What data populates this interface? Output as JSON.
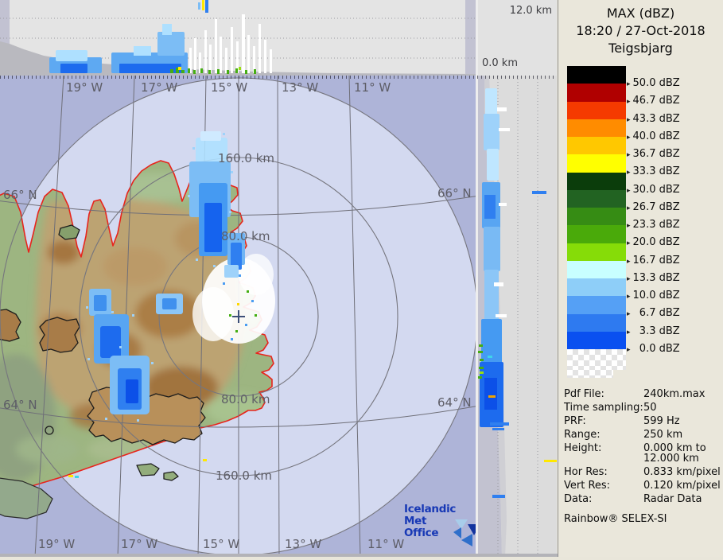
{
  "header": {
    "product": "MAX (dBZ)",
    "datetime": "18:20 / 27-Oct-2018",
    "station": "Teigsbjarg"
  },
  "vaxis": {
    "max": "12.0 km",
    "min": "0.0 km"
  },
  "map": {
    "lon_top": [
      "19° W",
      "17° W",
      "15° W",
      "13° W",
      "11° W"
    ],
    "lon_bottom": [
      "19° W",
      "17° W",
      "15° W",
      "13° W",
      "11° W"
    ],
    "lat_left": [
      "66° N",
      "64° N"
    ],
    "lat_right": [
      "66° N",
      "64° N"
    ],
    "rings": [
      "160.0 km",
      "80.0 km",
      "80.0 km",
      "160.0 km"
    ],
    "logo": {
      "line1": "Icelandic Met",
      "line2": "Office"
    }
  },
  "legend": {
    "bands": [
      {
        "color": "#000000",
        "label": "50.0 dBZ"
      },
      {
        "color": "#b00000",
        "label": "46.7 dBZ"
      },
      {
        "color": "#f53a00",
        "label": "43.3 dBZ"
      },
      {
        "color": "#ff8c00",
        "label": "40.0 dBZ"
      },
      {
        "color": "#ffc800",
        "label": "36.7 dBZ"
      },
      {
        "color": "#ffff00",
        "label": "33.3 dBZ"
      },
      {
        "color": "#0b3d0b",
        "label": "30.0 dBZ"
      },
      {
        "color": "#226322",
        "label": "26.7 dBZ"
      },
      {
        "color": "#368c14",
        "label": "23.3 dBZ"
      },
      {
        "color": "#4aaa0a",
        "label": "20.0 dBZ"
      },
      {
        "color": "#86dc08",
        "label": "16.7 dBZ"
      },
      {
        "color": "#c8ffff",
        "label": "13.3 dBZ"
      },
      {
        "color": "#8ecef8",
        "label": "10.0 dBZ"
      },
      {
        "color": "#55a0f5",
        "label": "  6.7 dBZ"
      },
      {
        "color": "#2e7af0",
        "label": "  3.3 dBZ"
      },
      {
        "color": "#0a50f0",
        "label": "  0.0 dBZ"
      }
    ]
  },
  "info": {
    "rows": [
      {
        "label": "Pdf File:",
        "value": "240km.max"
      },
      {
        "label": "Time sampling:",
        "value": "50"
      },
      {
        "label": "PRF:",
        "value": "599 Hz"
      },
      {
        "label": "Range:",
        "value": "250 km"
      },
      {
        "label": "Height:",
        "value": "0.000 km to\n12.000 km"
      },
      {
        "label": "Hor Res:",
        "value": "0.833 km/pixel"
      },
      {
        "label": "Vert Res:",
        "value": "0.120 km/pixel"
      },
      {
        "label": "Data:",
        "value": "Radar Data"
      }
    ],
    "brand": "Rainbow® SELEX-SI"
  },
  "colors": {
    "sea_outer": "#aeb4d8",
    "sea_inner": "#d3d9f0",
    "coastline": "#e8241c",
    "land": "#9db581",
    "panel_bg": "#e4e4e4",
    "sidebar_bg": "#eae7db",
    "echo_strong": "#0a50f0",
    "echo_mid": "#459af2",
    "echo_pale": "#aee0ff"
  }
}
